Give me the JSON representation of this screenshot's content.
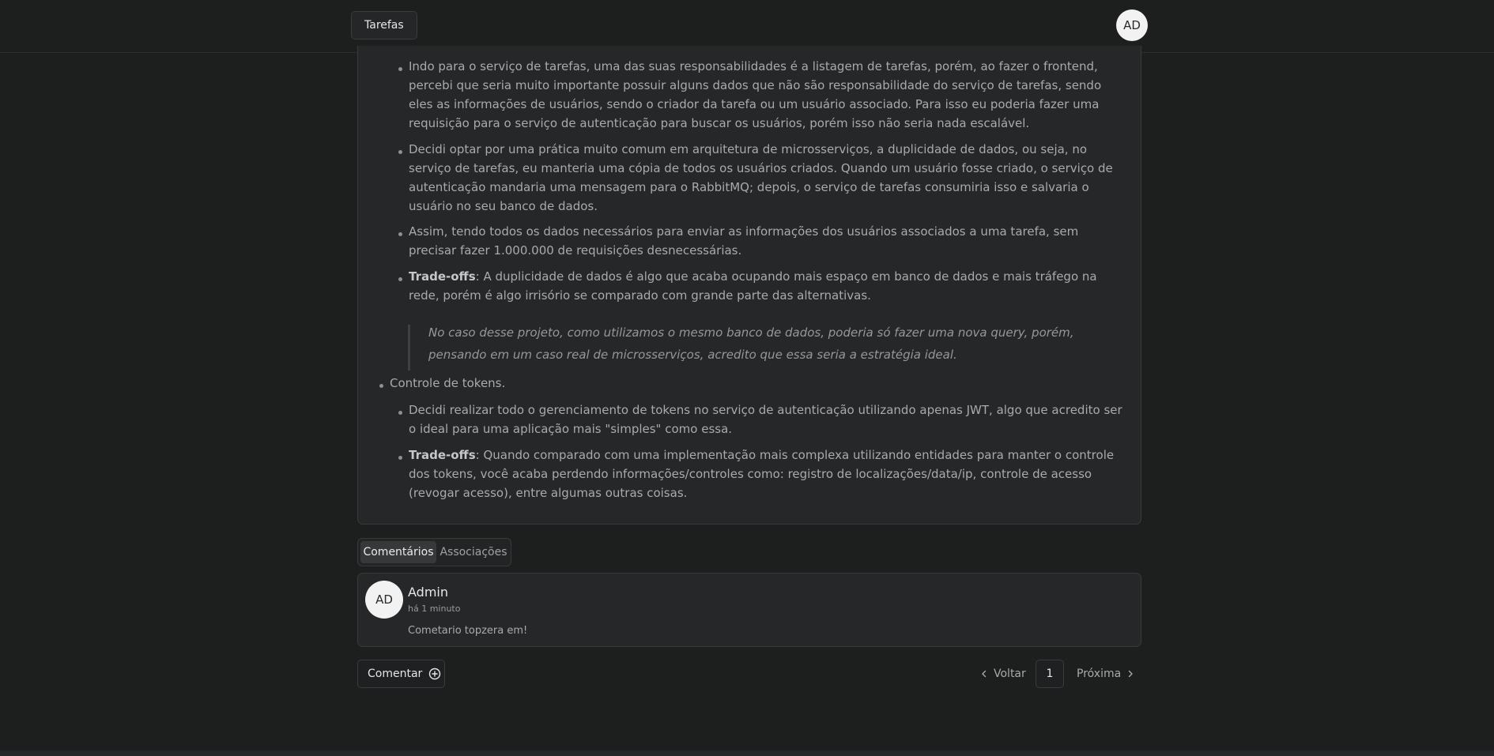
{
  "header": {
    "nav_label": "Tarefas",
    "avatar_initials": "AD"
  },
  "content": {
    "tasks_listing": "Indo para o serviço de tarefas, uma das suas responsabilidades é a listagem de tarefas, porém, ao fazer o frontend, percebi que seria muito importante possuir alguns dados que não são responsabilidade do serviço de tarefas, sendo eles as informações de usuários, sendo o criador da tarefa ou um usuário associado. Para isso eu poderia fazer uma requisição para o serviço de autenticação para buscar os usuários, porém isso não seria nada escalável.",
    "duplication_decision": "Decidi optar por uma prática muito comum em arquitetura de microsserviços, a duplicidade de dados, ou seja, no serviço de tarefas, eu manteria uma cópia de todos os usuários criados. Quando um usuário fosse criado, o serviço de autenticação mandaria uma mensagem para o RabbitMQ; depois, o serviço de tarefas consumiria isso e salvaria o usuário no seu banco de dados.",
    "result": "Assim, tendo todos os dados necessários para enviar as informações dos usuários associados a uma tarefa, sem precisar fazer 1.000.000 de requisições desnecessárias.",
    "tradeoff1_label": "Trade-offs",
    "tradeoff1_text": ": A duplicidade de dados é algo que acaba ocupando mais espaço em banco de dados e mais tráfego na rede, porém é algo irrisório se comparado com grande parte das alternativas.",
    "quote": "No caso desse projeto, como utilizamos o mesmo banco de dados, poderia só fazer uma nova query, porém, pensando em um caso real de microsserviços, acredito que essa seria a estratégia ideal.",
    "tokens_heading": "Controle de tokens.",
    "tokens_decision": "Decidi realizar todo o gerenciamento de tokens no serviço de autenticação utilizando apenas JWT, algo que acredito ser o ideal para uma aplicação mais \"simples\" como essa.",
    "tradeoff2_label": "Trade-offs",
    "tradeoff2_text": ": Quando comparado com uma implementação mais complexa utilizando entidades para manter o controle dos tokens, você acaba perdendo informações/controles como: registro de localizações/data/ip, controle de acesso (revogar acesso), entre algumas outras coisas."
  },
  "tabs": {
    "comments": "Comentários",
    "associations": "Associações"
  },
  "comment": {
    "avatar_initials": "AD",
    "author": "Admin",
    "time": "há 1 minuto",
    "text": "Cometario topzera em!"
  },
  "footer": {
    "comment_button": "Comentar",
    "prev": "Voltar",
    "page": "1",
    "next": "Próxima"
  },
  "colors": {
    "background": "#1d1e1e",
    "card": "#262729",
    "border": "#38393b",
    "text": "#a9aaab",
    "text_strong": "#e6e6e6"
  },
  "icons": [
    "plus-circle-icon",
    "chevron-left-icon",
    "chevron-right-icon"
  ]
}
